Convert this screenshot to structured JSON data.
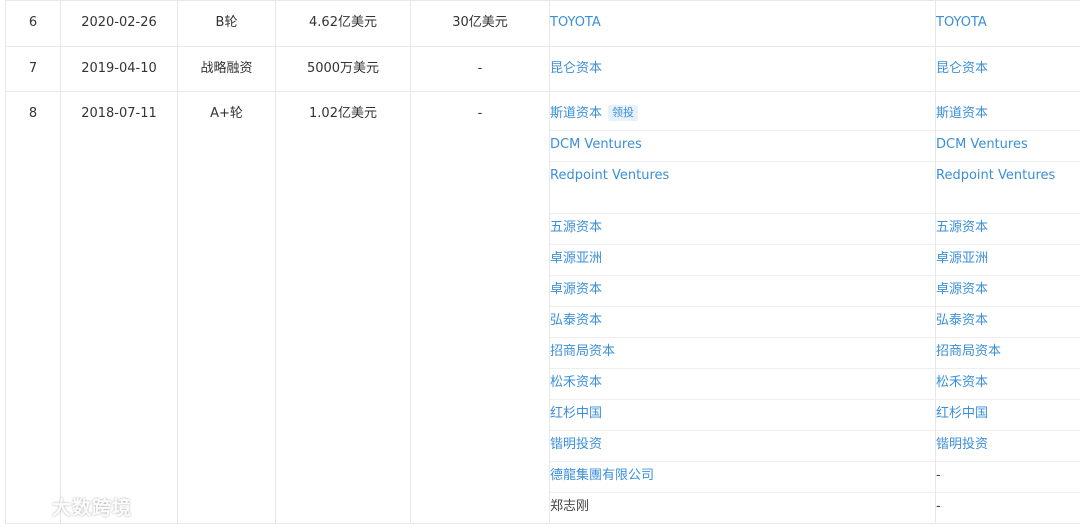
{
  "rows": [
    {
      "index": "6",
      "date": "2020-02-26",
      "round": "B轮",
      "amount": "4.62亿美元",
      "valuation": "30亿美元",
      "investors": [
        {
          "name": "TOYOTA",
          "link": true
        }
      ],
      "investors_right": [
        {
          "name": "TOYOTA",
          "link": true
        }
      ]
    },
    {
      "index": "7",
      "date": "2019-04-10",
      "round": "战略融资",
      "amount": "5000万美元",
      "valuation": "-",
      "investors": [
        {
          "name": "昆仑资本",
          "link": true
        }
      ],
      "investors_right": [
        {
          "name": "昆仑资本",
          "link": true
        }
      ]
    },
    {
      "index": "8",
      "date": "2018-07-11",
      "round": "A+轮",
      "amount": "1.02亿美元",
      "valuation": "-",
      "lead_tag": "领投",
      "investors": [
        {
          "name": "斯道资本",
          "link": true
        },
        {
          "name": "DCM Ventures",
          "link": true
        },
        {
          "name": "Redpoint Ventures",
          "link": true
        },
        {
          "name": "五源资本",
          "link": true
        },
        {
          "name": "卓源亚洲",
          "link": true
        },
        {
          "name": "卓源资本",
          "link": true
        },
        {
          "name": "弘泰资本",
          "link": true
        },
        {
          "name": "招商局资本",
          "link": true
        },
        {
          "name": "松禾资本",
          "link": true
        },
        {
          "name": "红杉中国",
          "link": true
        },
        {
          "name": "锴明投资",
          "link": true
        },
        {
          "name": "德龍集團有限公司",
          "link": true
        },
        {
          "name": "郑志刚",
          "link": false
        }
      ],
      "investors_right": [
        {
          "name": "斯道资本",
          "link": true
        },
        {
          "name": "DCM Ventures",
          "link": true
        },
        {
          "name": "Redpoint Ventures",
          "link": true
        },
        {
          "name": "五源资本",
          "link": true
        },
        {
          "name": "卓源亚洲",
          "link": true
        },
        {
          "name": "卓源资本",
          "link": true
        },
        {
          "name": "弘泰资本",
          "link": true
        },
        {
          "name": "招商局资本",
          "link": true
        },
        {
          "name": "松禾资本",
          "link": true
        },
        {
          "name": "红杉中国",
          "link": true
        },
        {
          "name": "锴明投资",
          "link": true
        },
        {
          "name": "-",
          "link": false
        },
        {
          "name": "-",
          "link": false
        }
      ]
    }
  ],
  "watermark": "大数跨境",
  "colors": {
    "link": "#3b8fd8",
    "border": "#e8e8e8",
    "tag_bg": "#e6f1fb"
  }
}
